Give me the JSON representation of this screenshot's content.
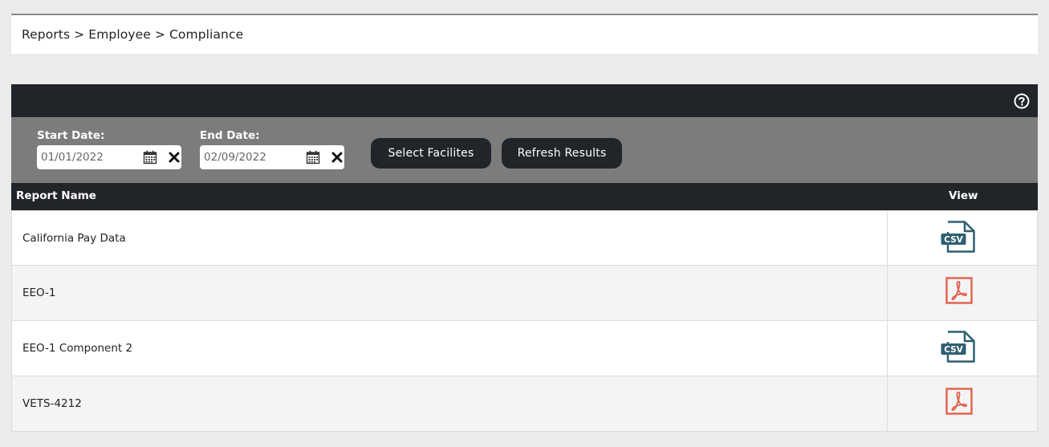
{
  "breadcrumb": {
    "text": "Reports > Employee > Compliance"
  },
  "header": {
    "help_icon": "question-circle-icon"
  },
  "filters": {
    "start_date": {
      "label": "Start Date:",
      "value": "01/01/2022"
    },
    "end_date": {
      "label": "End Date:",
      "value": "02/09/2022"
    },
    "select_facilities_label": "Select Facilites",
    "refresh_label": "Refresh Results"
  },
  "table": {
    "columns": {
      "name": "Report Name",
      "view": "View"
    },
    "rows": [
      {
        "name": "California Pay Data",
        "file_type": "csv"
      },
      {
        "name": "EEO-1",
        "file_type": "pdf"
      },
      {
        "name": "EEO-1 Component 2",
        "file_type": "csv"
      },
      {
        "name": "VETS-4212",
        "file_type": "pdf"
      }
    ]
  },
  "colors": {
    "dark": "#212429",
    "filter_bar": "#7c7c7c",
    "csv_icon": "#2f5f70",
    "pdf_icon": "#e0604c"
  }
}
